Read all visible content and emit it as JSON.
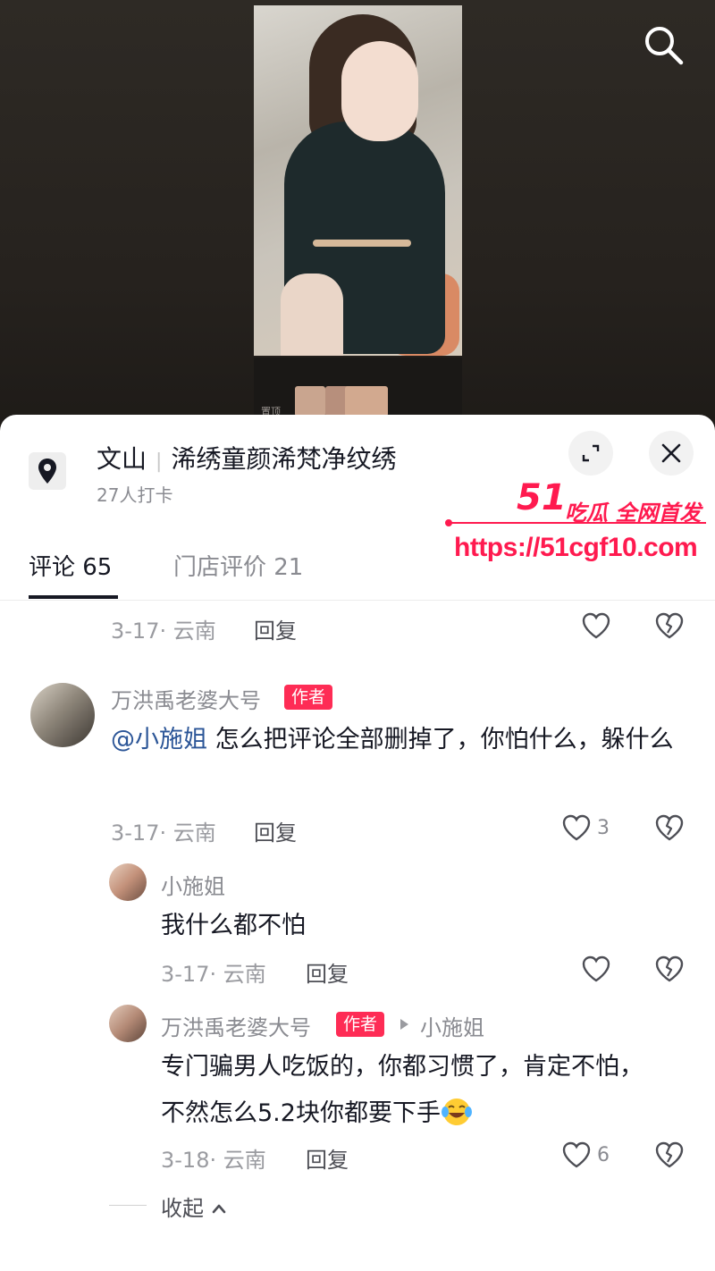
{
  "header": {
    "search_icon": "search-icon",
    "strip_label": "置顶"
  },
  "sheet": {
    "location_icon": "location-pin-icon",
    "title_city": "文山",
    "title_store": "浠绣童颜浠梵净纹绣",
    "subtitle": "27人打卡",
    "expand_icon": "expand-icon",
    "close_icon": "close-icon"
  },
  "watermark": {
    "number": "51",
    "slogan": "吃瓜 全网首发",
    "url": "https://51cgf10.com",
    "color": "#ff1a4f"
  },
  "tabs": [
    {
      "label": "评论 65",
      "active": true
    },
    {
      "label": "门店评价 21",
      "active": false
    }
  ],
  "comments": {
    "partial": {
      "date": "3-17",
      "region": "云南",
      "reply": "回复"
    },
    "main": {
      "author": "万洪禹老婆大号",
      "badge": "作者",
      "mention": "@小施姐",
      "text": "怎么把评论全部删掉了，你怕什么，躲什么",
      "date": "3-17",
      "region": "云南",
      "reply": "回复",
      "likes": "3"
    },
    "replies": [
      {
        "author": "小施姐",
        "text": "我什么都不怕",
        "date": "3-17",
        "region": "云南",
        "reply": "回复",
        "likes": ""
      },
      {
        "author": "万洪禹老婆大号",
        "badge": "作者",
        "reply_to": "小施姐",
        "text": "专门骗男人吃饭的，你都习惯了，肯定不怕，不然怎么5.2块你都要下手",
        "emoji": "laugh-cry-emoji",
        "date": "3-18",
        "region": "云南",
        "reply": "回复",
        "likes": "6"
      }
    ],
    "collapse_label": "收起"
  },
  "colors": {
    "accent": "#fe2c55",
    "mention": "#2b5597",
    "text": "#161823",
    "muted": "#8a8b91"
  }
}
